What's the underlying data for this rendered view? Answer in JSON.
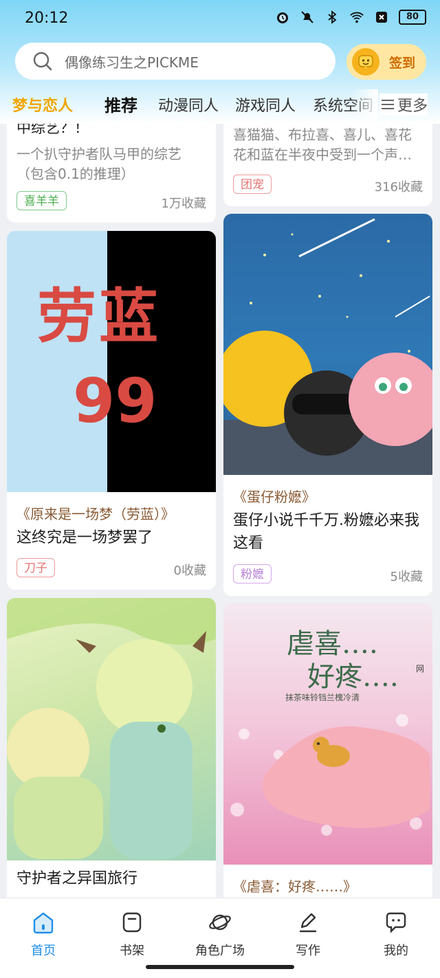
{
  "status_bar": {
    "time": "20:12",
    "battery": "80"
  },
  "search": {
    "placeholder": "偶像练习生之PICKME",
    "checkin_label": "签到"
  },
  "tabs": [
    {
      "label": "梦与恋人"
    },
    {
      "label": "推荐"
    },
    {
      "label": "动漫同人"
    },
    {
      "label": "游戏同人"
    },
    {
      "label": "系统空间"
    }
  ],
  "more_label": "更多",
  "cards": [
    {
      "title": "中综艺？！",
      "desc": "一个扒守护者队马甲的综艺（包含0.1的推理）",
      "tag": "喜羊羊",
      "favs": "1万收藏"
    },
    {
      "desc": "喜猫猫、布拉喜、喜儿、喜花花和蓝在半夜中受到一个声…",
      "tag": "团宠",
      "favs": "316收藏"
    },
    {
      "cover_text": "劳蓝",
      "cover_number": "99",
      "book": "《原来是一场梦（劳蓝）》",
      "title": "这终究是一场梦罢了",
      "tag": "刀子",
      "favs": "0收藏"
    },
    {
      "book": "《蛋仔粉嬷》",
      "title": "蛋仔小说千千万.粉嬷必来我这看",
      "tag": "粉嬷",
      "favs": "5收藏"
    },
    {
      "title": "守护者之异国旅行"
    },
    {
      "cover_title_1": "虐喜….",
      "cover_title_2": "好疼….",
      "cover_sub": "抹茶味铃铛兰槐冷清",
      "cover_side": "网",
      "book": "《虐喜：好疼……》"
    }
  ],
  "nav": [
    {
      "label": "首页",
      "icon": "home-icon"
    },
    {
      "label": "书架",
      "icon": "bookshelf-icon"
    },
    {
      "label": "角色广场",
      "icon": "planet-icon"
    },
    {
      "label": "写作",
      "icon": "pen-icon"
    },
    {
      "label": "我的",
      "icon": "chat-icon"
    }
  ],
  "colors": {
    "accent": "#f0a500",
    "nav_active": "#1f8ee6",
    "tag_green": "#4caf50",
    "tag_red": "#e57373",
    "tag_purple": "#b77fd6"
  }
}
